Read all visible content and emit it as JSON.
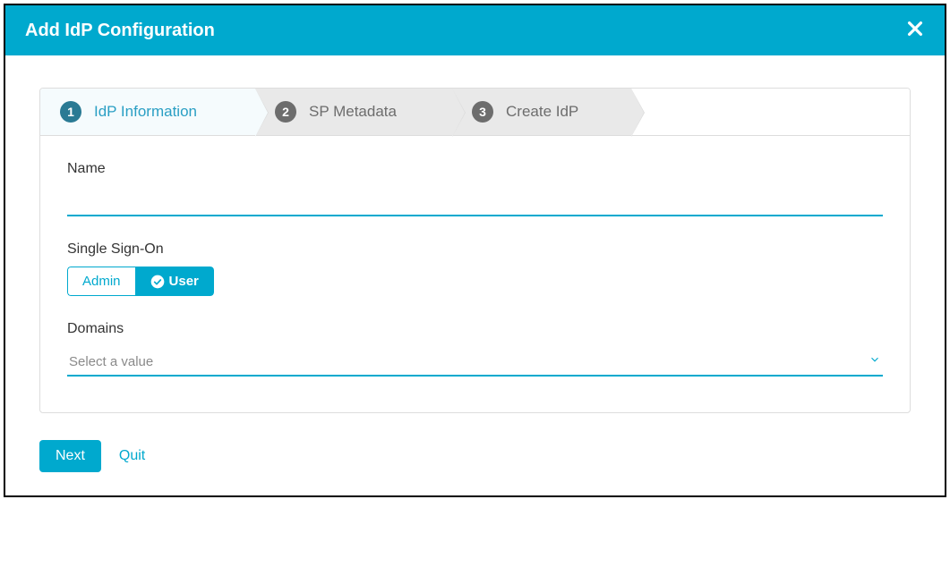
{
  "header": {
    "title": "Add IdP Configuration"
  },
  "steps": [
    {
      "num": "1",
      "label": "IdP Information",
      "active": true
    },
    {
      "num": "2",
      "label": "SP Metadata",
      "active": false
    },
    {
      "num": "3",
      "label": "Create IdP",
      "active": false
    }
  ],
  "form": {
    "name_label": "Name",
    "name_value": "",
    "sso_label": "Single Sign-On",
    "sso_options": {
      "admin": "Admin",
      "user": "User"
    },
    "domains_label": "Domains",
    "domains_placeholder": "Select a value"
  },
  "footer": {
    "next": "Next",
    "quit": "Quit"
  }
}
